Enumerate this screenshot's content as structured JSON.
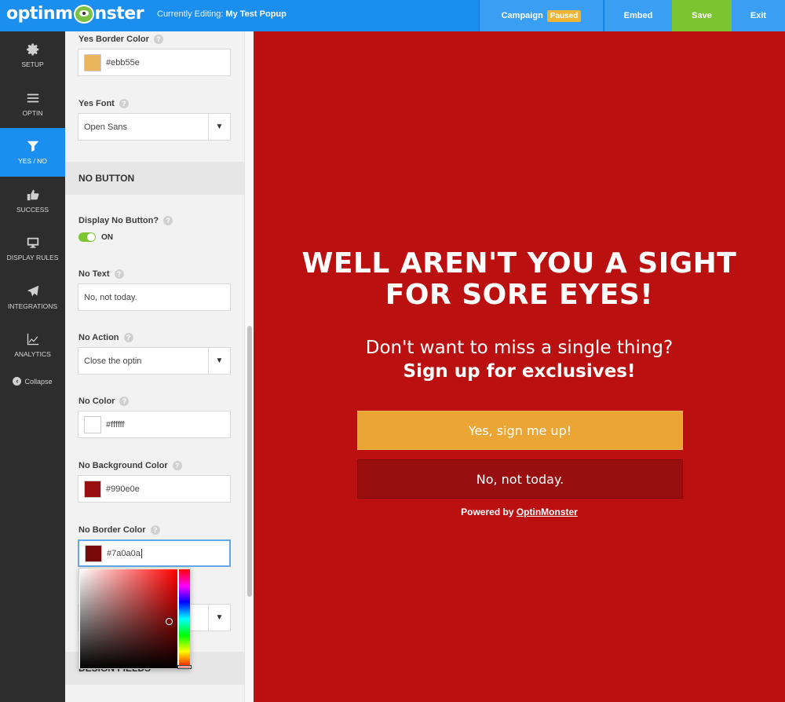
{
  "topbar": {
    "logo_left": "optinm",
    "logo_right": "nster",
    "editing_label": "Currently Editing:",
    "editing_name": "My Test Popup",
    "campaign_label": "Campaign",
    "status_badge": "Paused",
    "embed_label": "Embed",
    "save_label": "Save",
    "exit_label": "Exit",
    "colors": {
      "bar": "#1b8ff0",
      "save": "#7cc431",
      "badge": "#f0b333"
    }
  },
  "nav": {
    "items": [
      {
        "label": "Setup",
        "icon": "gear-icon"
      },
      {
        "label": "Optin",
        "icon": "menu-icon"
      },
      {
        "label": "Yes / No",
        "icon": "filter-icon",
        "active": true
      },
      {
        "label": "Success",
        "icon": "thumbs-up-icon"
      },
      {
        "label": "Display Rules",
        "icon": "monitor-icon"
      },
      {
        "label": "Integrations",
        "icon": "paper-plane-icon"
      },
      {
        "label": "Analytics",
        "icon": "chart-icon"
      }
    ],
    "collapse_label": "Collapse"
  },
  "panel": {
    "yes_border_color_label": "Yes Border Color",
    "yes_border_color_value": "#ebb55e",
    "yes_font_label": "Yes Font",
    "yes_font_value": "Open Sans",
    "no_button_section": "NO BUTTON",
    "display_no_label": "Display No Button?",
    "display_no_state": "ON",
    "no_text_label": "No Text",
    "no_text_value": "No, not today.",
    "no_action_label": "No Action",
    "no_action_value": "Close the optin",
    "no_color_label": "No Color",
    "no_color_value": "#ffffff",
    "no_bg_label": "No Background Color",
    "no_bg_value": "#990e0e",
    "no_border_label": "No Border Color",
    "no_border_value": "#7a0a0a",
    "design_fields_section": "DESIGN FIELDS"
  },
  "preview": {
    "headline_line1": "WELL AREN'T YOU A SIGHT",
    "headline_line2": "FOR SORE EYES!",
    "subheading": "Don't want to miss a single thing?",
    "subheading_bold": "Sign up for exclusives!",
    "yes_button": "Yes, sign me up!",
    "no_button": "No, not today.",
    "powered_by": "Powered by",
    "powered_link": "OptinMonster",
    "background_color": "#bb1010"
  }
}
